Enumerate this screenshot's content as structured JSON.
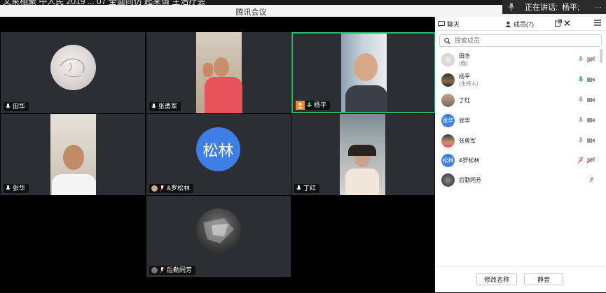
{
  "desktop": {
    "background_text": "又来相聚  中人民  2019 ...    07    全面同仿  起来请  主治疗会"
  },
  "speaker_banner": {
    "label": "正在讲话:",
    "name": "杨平;"
  },
  "window": {
    "title": "腾讯会议"
  },
  "participants_video": [
    {
      "name": "田华",
      "camera": "off",
      "muted": false
    },
    {
      "name": "张勇军",
      "camera": "on",
      "muted": false
    },
    {
      "name": "杨平",
      "camera": "on",
      "muted": false,
      "speaking": true,
      "host": true
    },
    {
      "name": "张华",
      "camera": "on",
      "muted": false
    },
    {
      "name": "&罗松林",
      "camera": "off",
      "muted": true,
      "avatar_text": "松林"
    },
    {
      "name": "丁红",
      "camera": "on",
      "muted": false
    },
    {
      "name": "后勤同芳",
      "camera": "off",
      "muted": true
    }
  ],
  "panel": {
    "tab_chat": "聊天",
    "tab_members": "成员(7)",
    "search_placeholder": "搜索成员",
    "members": [
      {
        "name": "田华",
        "note": "(我)",
        "avatar_text": "",
        "mic": "on",
        "camera": "off"
      },
      {
        "name": "杨平",
        "note": "(主持人)",
        "avatar_text": "",
        "mic": "speaking",
        "camera": "on"
      },
      {
        "name": "丁红",
        "note": "",
        "avatar_text": "",
        "mic": "on",
        "camera": "on"
      },
      {
        "name": "张华",
        "note": "",
        "avatar_text": "张华",
        "mic": "on",
        "camera": "on"
      },
      {
        "name": "张勇军",
        "note": "",
        "avatar_text": "",
        "mic": "on",
        "camera": "on"
      },
      {
        "name": "&罗松林",
        "note": "",
        "avatar_text": "松林",
        "mic": "muted",
        "camera": "off"
      },
      {
        "name": "后勤同芳",
        "note": "",
        "avatar_text": "",
        "mic": "muted",
        "camera": "none"
      }
    ],
    "rename_button": "修改名称",
    "mute_button": "静音"
  },
  "colors": {
    "accent_green": "#2fb56a",
    "avatar_blue": "#3d7fe6",
    "host_orange": "#f08a24",
    "muted_red": "#e0433a"
  }
}
